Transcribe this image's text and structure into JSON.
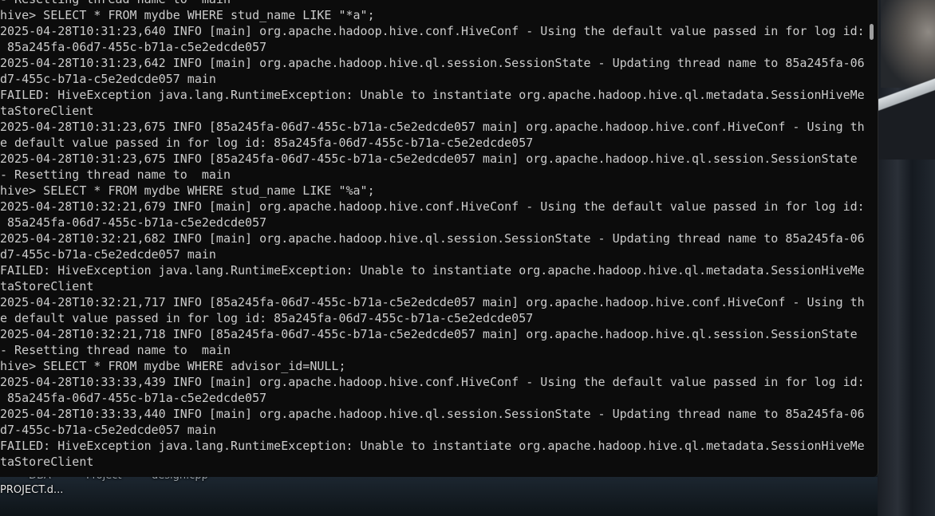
{
  "desktop": {
    "icons": [
      {
        "name": "DBA",
        "label": "DBA"
      },
      {
        "name": "project",
        "label": "Project"
      },
      {
        "name": "design",
        "label": "design.cpp"
      },
      {
        "name": "project-doc",
        "label": "PROJECT.d..."
      }
    ]
  },
  "terminal": {
    "lines": [
      "- Resetting thread name to  main",
      "hive> SELECT * FROM mydbe WHERE stud_name LIKE \"*a\";",
      "2025-04-28T10:31:23,640 INFO [main] org.apache.hadoop.hive.conf.HiveConf - Using the default value passed in for log id:",
      " 85a245fa-06d7-455c-b71a-c5e2edcde057",
      "2025-04-28T10:31:23,642 INFO [main] org.apache.hadoop.hive.ql.session.SessionState - Updating thread name to 85a245fa-06",
      "d7-455c-b71a-c5e2edcde057 main",
      "FAILED: HiveException java.lang.RuntimeException: Unable to instantiate org.apache.hadoop.hive.ql.metadata.SessionHiveMe",
      "taStoreClient",
      "2025-04-28T10:31:23,675 INFO [85a245fa-06d7-455c-b71a-c5e2edcde057 main] org.apache.hadoop.hive.conf.HiveConf - Using th",
      "e default value passed in for log id: 85a245fa-06d7-455c-b71a-c5e2edcde057",
      "2025-04-28T10:31:23,675 INFO [85a245fa-06d7-455c-b71a-c5e2edcde057 main] org.apache.hadoop.hive.ql.session.SessionState",
      "- Resetting thread name to  main",
      "hive> SELECT * FROM mydbe WHERE stud_name LIKE \"%a\";",
      "2025-04-28T10:32:21,679 INFO [main] org.apache.hadoop.hive.conf.HiveConf - Using the default value passed in for log id:",
      " 85a245fa-06d7-455c-b71a-c5e2edcde057",
      "2025-04-28T10:32:21,682 INFO [main] org.apache.hadoop.hive.ql.session.SessionState - Updating thread name to 85a245fa-06",
      "d7-455c-b71a-c5e2edcde057 main",
      "FAILED: HiveException java.lang.RuntimeException: Unable to instantiate org.apache.hadoop.hive.ql.metadata.SessionHiveMe",
      "taStoreClient",
      "2025-04-28T10:32:21,717 INFO [85a245fa-06d7-455c-b71a-c5e2edcde057 main] org.apache.hadoop.hive.conf.HiveConf - Using th",
      "e default value passed in for log id: 85a245fa-06d7-455c-b71a-c5e2edcde057",
      "2025-04-28T10:32:21,718 INFO [85a245fa-06d7-455c-b71a-c5e2edcde057 main] org.apache.hadoop.hive.ql.session.SessionState",
      "- Resetting thread name to  main",
      "hive> SELECT * FROM mydbe WHERE advisor_id=NULL;",
      "2025-04-28T10:33:33,439 INFO [main] org.apache.hadoop.hive.conf.HiveConf - Using the default value passed in for log id:",
      " 85a245fa-06d7-455c-b71a-c5e2edcde057",
      "2025-04-28T10:33:33,440 INFO [main] org.apache.hadoop.hive.ql.session.SessionState - Updating thread name to 85a245fa-06",
      "d7-455c-b71a-c5e2edcde057 main",
      "FAILED: HiveException java.lang.RuntimeException: Unable to instantiate org.apache.hadoop.hive.ql.metadata.SessionHiveMe",
      "taStoreClient"
    ]
  }
}
